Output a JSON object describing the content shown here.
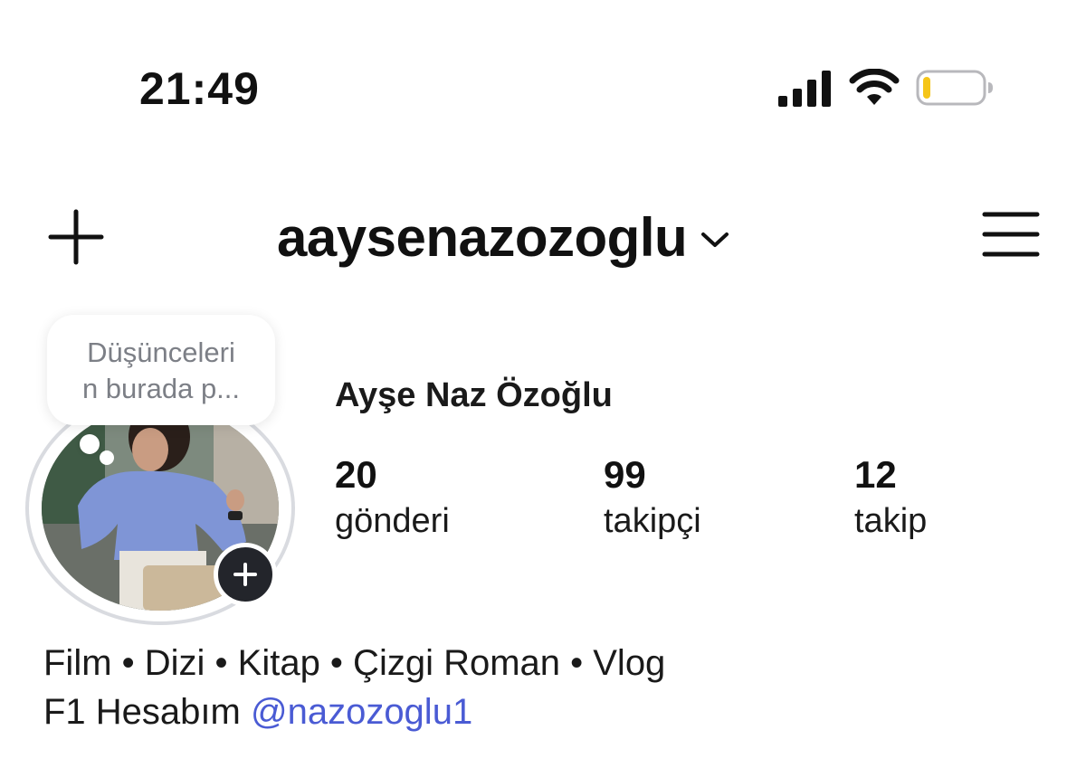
{
  "status_bar": {
    "time": "21:49",
    "signal_icon": "cellular-signal-icon",
    "wifi_icon": "wifi-icon",
    "battery_icon": "battery-low-icon",
    "battery_level": 0.1,
    "battery_color": "#f5c518"
  },
  "header": {
    "add_icon": "plus-icon",
    "username": "aaysenazozoglu",
    "switch_account_icon": "chevron-down-icon",
    "menu_icon": "hamburger-menu-icon"
  },
  "note": {
    "line1": "Düşünceleri",
    "line2": "n burada p..."
  },
  "profile": {
    "display_name": "Ayşe Naz Özoğlu",
    "avatar_description": "profile-photo",
    "add_story_icon": "plus-icon"
  },
  "stats": [
    {
      "value": "20",
      "label": "gönderi"
    },
    {
      "value": "99",
      "label": "takipçi"
    },
    {
      "value": "12",
      "label": "takip"
    }
  ],
  "bio": {
    "line1": "Film • Dizi • Kitap • Çizgi Roman • Vlog",
    "line2_text": "F1 Hesabım ",
    "line2_mention": "@nazozoglu1"
  },
  "colors": {
    "mention": "#4a5bd4",
    "text": "#111111",
    "muted": "#7c7f86"
  }
}
